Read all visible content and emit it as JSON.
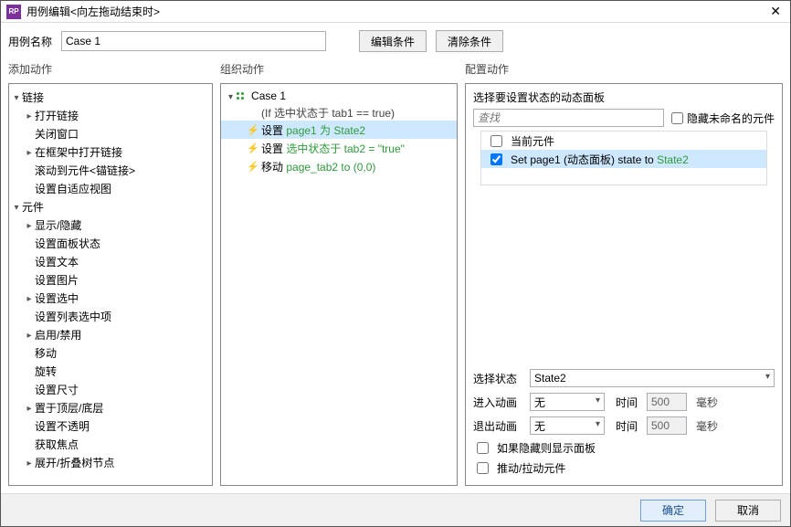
{
  "window": {
    "title": "用例编辑<向左拖动结束时>"
  },
  "toprow": {
    "case_name_label": "用例名称",
    "case_name_value": "Case 1",
    "edit_conditions": "编辑条件",
    "clear_conditions": "清除条件"
  },
  "col_headers": {
    "left": "添加动作",
    "mid": "组织动作",
    "right": "配置动作"
  },
  "left_tree": {
    "items": [
      {
        "label": "链接",
        "depth": 0,
        "caret": "down"
      },
      {
        "label": "打开链接",
        "depth": 1,
        "caret": "right"
      },
      {
        "label": "关闭窗口",
        "depth": 1,
        "caret": "none"
      },
      {
        "label": "在框架中打开链接",
        "depth": 1,
        "caret": "right"
      },
      {
        "label": "滚动到元件<锚链接>",
        "depth": 1,
        "caret": "none"
      },
      {
        "label": "设置自适应视图",
        "depth": 1,
        "caret": "none"
      },
      {
        "label": "元件",
        "depth": 0,
        "caret": "down"
      },
      {
        "label": "显示/隐藏",
        "depth": 1,
        "caret": "right"
      },
      {
        "label": "设置面板状态",
        "depth": 1,
        "caret": "none"
      },
      {
        "label": "设置文本",
        "depth": 1,
        "caret": "none"
      },
      {
        "label": "设置图片",
        "depth": 1,
        "caret": "none"
      },
      {
        "label": "设置选中",
        "depth": 1,
        "caret": "right"
      },
      {
        "label": "设置列表选中项",
        "depth": 1,
        "caret": "none"
      },
      {
        "label": "启用/禁用",
        "depth": 1,
        "caret": "right"
      },
      {
        "label": "移动",
        "depth": 1,
        "caret": "none"
      },
      {
        "label": "旋转",
        "depth": 1,
        "caret": "none"
      },
      {
        "label": "设置尺寸",
        "depth": 1,
        "caret": "none"
      },
      {
        "label": "置于顶层/底层",
        "depth": 1,
        "caret": "right"
      },
      {
        "label": "设置不透明",
        "depth": 1,
        "caret": "none"
      },
      {
        "label": "获取焦点",
        "depth": 1,
        "caret": "none"
      },
      {
        "label": "展开/折叠树节点",
        "depth": 1,
        "caret": "right"
      }
    ]
  },
  "mid": {
    "case_name": "Case 1",
    "if_clause": "(If 选中状态于 tab1 == true)",
    "actions": [
      {
        "prefix": "设置 ",
        "suffix": "page1 为 State2",
        "selected": true
      },
      {
        "prefix": "设置 ",
        "suffix": "选中状态于 tab2  = \"true\"",
        "selected": false
      },
      {
        "prefix": "移动 ",
        "suffix": "page_tab2 to (0,0)",
        "selected": false
      }
    ]
  },
  "right": {
    "subheader": "选择要设置状态的动态面板",
    "search_placeholder": "查找",
    "hide_unnamed": "隐藏未命名的元件",
    "targets": [
      {
        "checked": false,
        "text": "当前元件",
        "after": ""
      },
      {
        "checked": true,
        "selected": true,
        "text": "Set page1 (动态面板) state to ",
        "after": "State2"
      }
    ],
    "select_state_label": "选择状态",
    "select_state_value": "State2",
    "anim_in_label": "进入动画",
    "anim_out_label": "退出动画",
    "anim_value": "无",
    "time_label": "时间",
    "time_value": "500",
    "time_unit": "毫秒",
    "show_if_hidden": "如果隐藏则显示面板",
    "push_pull": "推动/拉动元件"
  },
  "footer": {
    "ok": "确定",
    "cancel": "取消"
  }
}
